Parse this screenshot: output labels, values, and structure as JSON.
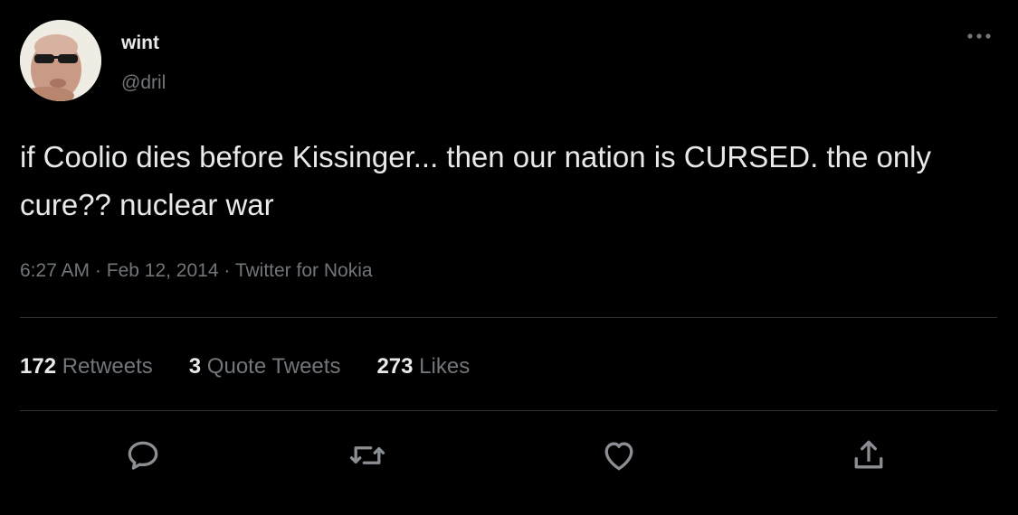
{
  "author": {
    "display_name": "wint",
    "handle": "@dril"
  },
  "tweet": {
    "text": "if Coolio dies before Kissinger... then our nation is CURSED. the only cure?? nuclear war",
    "time": "6:27 AM",
    "separator": "·",
    "date": "Feb 12, 2014",
    "source": "Twitter for Nokia"
  },
  "stats": {
    "retweets_count": "172",
    "retweets_label": "Retweets",
    "quotes_count": "3",
    "quotes_label": "Quote Tweets",
    "likes_count": "273",
    "likes_label": "Likes"
  },
  "icons": {
    "more": "more-horizontal-icon",
    "reply": "reply-icon",
    "retweet": "retweet-icon",
    "like": "heart-icon",
    "share": "share-icon"
  },
  "colors": {
    "background": "#000000",
    "primary_text": "#e7e9ea",
    "secondary_text": "#71767b",
    "divider": "#2f3336"
  }
}
